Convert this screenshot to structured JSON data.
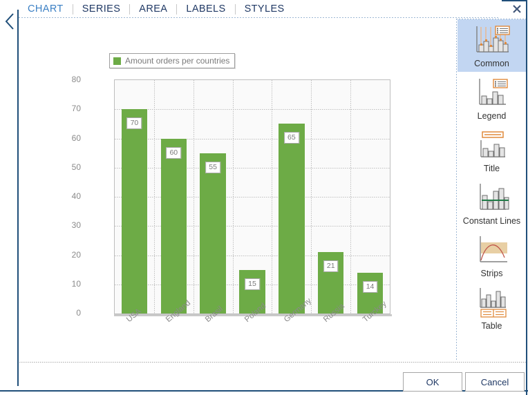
{
  "dialog": {
    "close_icon": "close-icon",
    "back_icon": "chevron-left-icon"
  },
  "tabs": [
    {
      "label": "CHART",
      "active": true
    },
    {
      "label": "SERIES",
      "active": false
    },
    {
      "label": "AREA",
      "active": false
    },
    {
      "label": "LABELS",
      "active": false
    },
    {
      "label": "STYLES",
      "active": false
    }
  ],
  "sidebar": {
    "items": [
      {
        "label": "Common",
        "icon": "common-chart-icon",
        "selected": true
      },
      {
        "label": "Legend",
        "icon": "legend-chart-icon",
        "selected": false
      },
      {
        "label": "Title",
        "icon": "title-chart-icon",
        "selected": false
      },
      {
        "label": "Constant Lines",
        "icon": "constant-lines-chart-icon",
        "selected": false
      },
      {
        "label": "Strips",
        "icon": "strips-chart-icon",
        "selected": false
      },
      {
        "label": "Table",
        "icon": "table-chart-icon",
        "selected": false
      }
    ]
  },
  "footer": {
    "ok_label": "OK",
    "cancel_label": "Cancel"
  },
  "colors": {
    "bar_green": "#6DAB46",
    "accent_blue": "#3A7FC4",
    "tab_text": "#1F3864",
    "selection_blue": "#C2D6F2",
    "icon_orange": "#E08A3C",
    "axis_gray": "#8A8A8A"
  },
  "chart_data": {
    "type": "bar",
    "title": "",
    "xlabel": "",
    "ylabel": "",
    "categories": [
      "USA",
      "England",
      "Brasil",
      "Poland",
      "Germany",
      "Russia",
      "Turckey"
    ],
    "values": [
      70,
      60,
      55,
      15,
      65,
      21,
      14
    ],
    "series": [
      {
        "name": "Amount orders per countries",
        "values": [
          70,
          60,
          55,
          15,
          65,
          21,
          14
        ],
        "color": "#6DAB46"
      }
    ],
    "legend": [
      "Amount orders per countries"
    ],
    "legend_position": "top-left",
    "ylim": [
      0,
      80
    ],
    "yticks": [
      0,
      10,
      20,
      30,
      40,
      50,
      60,
      70,
      80
    ],
    "ytick_labels": [
      "0",
      "10",
      "20",
      "30",
      "40",
      "50",
      "60",
      "70",
      "80"
    ],
    "data_labels": [
      "70",
      "60",
      "55",
      "15",
      "65",
      "21",
      "14"
    ],
    "grid": true,
    "grid_style": "dotted",
    "xtick_rotation": -40
  }
}
